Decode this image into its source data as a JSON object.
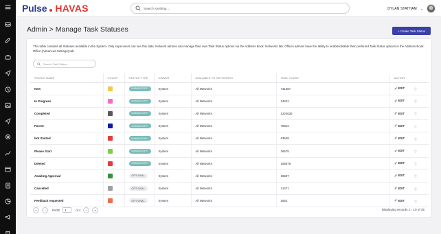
{
  "header": {
    "brand_primary": "Pulse",
    "brand_secondary": "HAVAS",
    "search_placeholder": "Search Anything ...",
    "user_name": "DYLAN STATHAM",
    "user_menu_icon": "chevron-down-icon"
  },
  "sidebar": {
    "icons": [
      "menu-icon",
      "inbox-icon",
      "rocket-icon",
      "briefcase-icon",
      "send-icon",
      "clock-icon",
      "image-icon",
      "send-icon",
      "settings-icon",
      "chart-icon",
      "calendar-icon",
      "list-icon",
      "pie-icon",
      "megaphone-icon",
      "book-icon",
      "send-icon",
      "chart-icon"
    ]
  },
  "page": {
    "title": "Admin > Manage Task Statuses",
    "create_button": "+ Create Task Status",
    "description": "This table contains all Statuses available in the System. Only superusers can see this data. Network admins can manage their own Task Status options via the Address Book: Networks tab. Offices admins have the ability to enable/disable their preferred Task Status options in the Address Book: Office (Advanced Settings) tab.",
    "filter_placeholder": "Search Task Status..."
  },
  "table": {
    "columns": [
      "STATUS NAME",
      "COLOR",
      "STATUS TYPE",
      "OWNER",
      "AVAILABLE TO NETWORKS",
      "TASK COUNT",
      "ACTION"
    ],
    "edit_label": "EDIT",
    "rows": [
      {
        "name": "New",
        "color": "#f2c94c",
        "type": "MANDATORY",
        "owner": "System",
        "networks": "All Networks",
        "count": "731387"
      },
      {
        "name": "In Progress",
        "color": "#f06ec9",
        "type": "MANDATORY",
        "owner": "System",
        "networks": "All Networks",
        "count": "34431"
      },
      {
        "name": "Completed",
        "color": "#5a5a5a",
        "type": "MANDATORY",
        "owner": "System",
        "networks": "All Networks",
        "count": "1224626"
      },
      {
        "name": "Parent",
        "color": "#1018a8",
        "type": "MANDATORY",
        "owner": "System",
        "networks": "All Networks",
        "count": "79812"
      },
      {
        "name": "Not Started",
        "color": "#e83a3a",
        "type": "MANDATORY",
        "owner": "System",
        "networks": "All Networks",
        "count": "63548"
      },
      {
        "name": "Please Start",
        "color": "#7ccf4a",
        "type": "MANDATORY",
        "owner": "System",
        "networks": "All Networks",
        "count": "26575"
      },
      {
        "name": "Deleted",
        "color": "#e83a3a",
        "type": "MANDATORY",
        "owner": "System",
        "networks": "All Networks",
        "count": "155879"
      },
      {
        "name": "Awaiting Approval",
        "color": "#3b8f3a",
        "type": "OPTIONAL",
        "owner": "System",
        "networks": "All Networks",
        "count": "15597"
      },
      {
        "name": "Cancelled",
        "color": "#a0a0a0",
        "type": "OPTIONAL",
        "owner": "System",
        "networks": "All Networks",
        "count": "41471"
      },
      {
        "name": "Feedback requested",
        "color": "#f06d4d",
        "type": "OPTIONAL",
        "owner": "System",
        "networks": "All Networks",
        "count": "2652"
      }
    ]
  },
  "pager": {
    "first": "«",
    "prev": "‹",
    "page_label": "PAGE",
    "current_page": "1",
    "of_label": "of 4",
    "next": "›",
    "last": "»",
    "summary": "Displaying records 1 - 10 of 35"
  }
}
